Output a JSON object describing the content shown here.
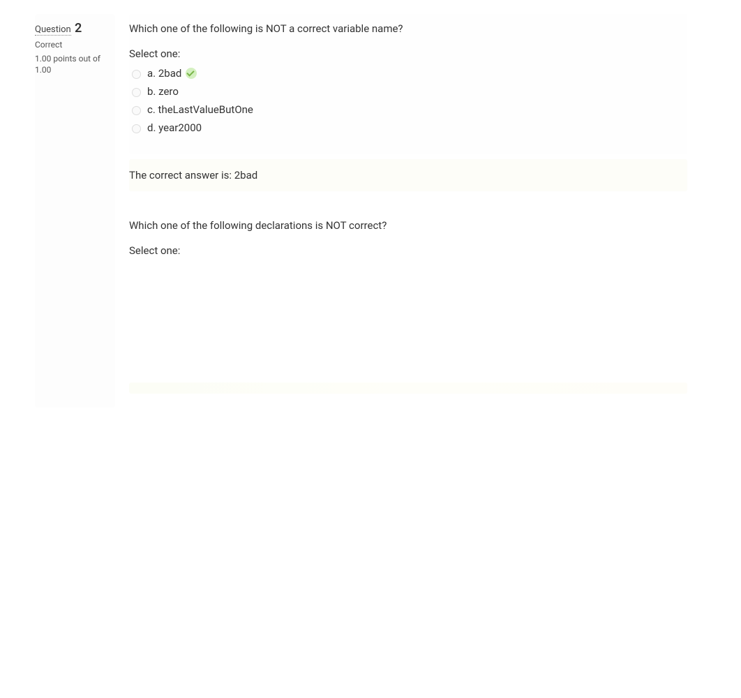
{
  "question2": {
    "label": "Question",
    "number": "2",
    "status": "Correct",
    "grade": "1.00 points out of 1.00",
    "prompt": "Which one of the following is NOT a correct variable name?",
    "select_label": "Select one:",
    "options": [
      {
        "letter": "a.",
        "text": "2bad",
        "correct": true
      },
      {
        "letter": "b.",
        "text": "zero",
        "correct": false
      },
      {
        "letter": "c.",
        "text": "theLastValueButOne",
        "correct": false
      },
      {
        "letter": "d.",
        "text": "year2000",
        "correct": false
      }
    ],
    "feedback": "The correct answer is: 2bad"
  },
  "question3": {
    "prompt": "Which one of the following declarations is NOT correct?",
    "select_label": "Select one:"
  }
}
